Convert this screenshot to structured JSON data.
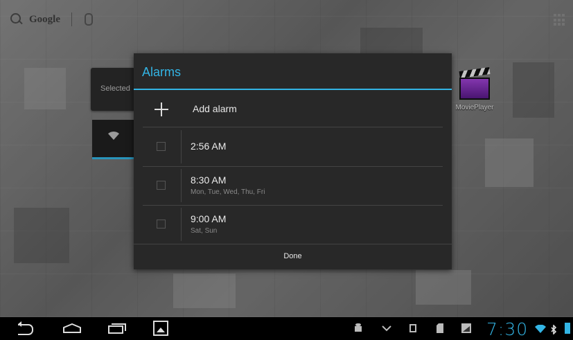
{
  "desktop": {
    "search_logo_text": "Google",
    "selected_widget_text": "Selected",
    "movie_app_label": "MoviePlayer"
  },
  "dialog": {
    "title": "Alarms",
    "add_label": "Add alarm",
    "alarms": [
      {
        "time": "2:56 AM",
        "days": ""
      },
      {
        "time": "8:30 AM",
        "days": "Mon, Tue, Wed, Thu, Fri"
      },
      {
        "time": "9:00 AM",
        "days": "Sat, Sun"
      }
    ],
    "done_label": "Done"
  },
  "statusbar": {
    "clock": "7:30"
  },
  "colors": {
    "accent": "#33b5e5",
    "dialog_bg": "#282828",
    "navbar_bg": "#000000"
  },
  "icons": [
    "search-icon",
    "mic-icon",
    "apps-grid-icon",
    "wifi-icon",
    "movie-clapper-icon",
    "plus-icon",
    "back-icon",
    "home-icon",
    "recent-apps-icon",
    "gallery-icon",
    "android-debug-icon",
    "chevron-down-icon",
    "usb-icon",
    "sd-card-icon",
    "screenshot-icon",
    "wifi-signal-icon",
    "bluetooth-icon",
    "battery-icon"
  ]
}
